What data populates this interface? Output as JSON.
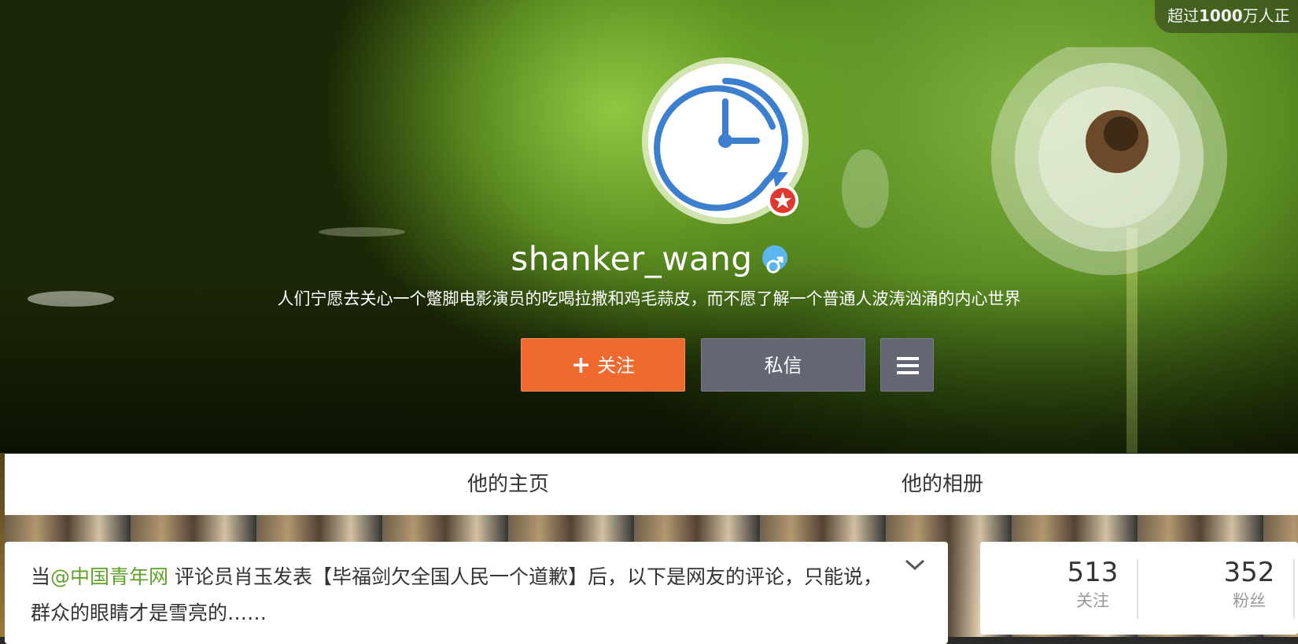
{
  "cover": {
    "top_badge_prefix": "超过",
    "top_badge_bold": "1000",
    "top_badge_suffix": "万人正"
  },
  "profile": {
    "username": "shanker_wang",
    "gender_symbol": "♂",
    "bio": "人们宁愿去关心一个蹩脚电影演员的吃喝拉撒和鸡毛蒜皮，而不愿了解一个普通人波涛汹涌的内心世界"
  },
  "actions": {
    "follow_label": "关注",
    "follow_symbol": "+",
    "message_label": "私信"
  },
  "tabs": [
    {
      "label": "他的主页"
    },
    {
      "label": "他的相册"
    }
  ],
  "post": {
    "prefix": "当",
    "mention": "@中国青年网",
    "body": " 评论员肖玉发表【毕福剑欠全国人民一个道歉】后，以下是网友的评论，只能说，群众的眼睛才是雪亮的……"
  },
  "stats": [
    {
      "value": "513",
      "label": "关注"
    },
    {
      "value": "352",
      "label": "粉丝"
    }
  ],
  "colors": {
    "follow_button": "#f0692f",
    "secondary_button": "#646773",
    "mention": "#61a12a",
    "verified_badge": "#e0372f",
    "gender_badge": "#5ab6ec"
  }
}
